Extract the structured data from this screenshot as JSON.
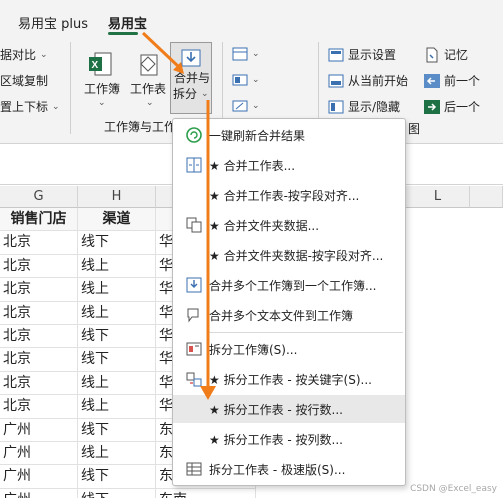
{
  "tabs": [
    {
      "label": "易用宝 plus",
      "active": false
    },
    {
      "label": "易用宝",
      "active": true
    }
  ],
  "ribbon": {
    "left_items": [
      "据对比",
      "区域复制",
      "置上下标"
    ],
    "workbook_label": "工作簿",
    "worksheet_label": "工作表",
    "merge_label_line1": "合并与",
    "merge_label_line2": "拆分",
    "group_label_partial": "工作簿与工作",
    "right_items": [
      "显示设置",
      "从当前开始",
      "显示/隐藏"
    ],
    "far_right_items": [
      "记忆",
      "前一个",
      "后一个"
    ],
    "group_label_right_partial": "图"
  },
  "columns": [
    "G",
    "H",
    "I",
    "L"
  ],
  "table": {
    "headers": [
      "销售门店",
      "渠道"
    ],
    "rows": [
      [
        "北京",
        "线下",
        "华"
      ],
      [
        "北京",
        "线上",
        "华"
      ],
      [
        "北京",
        "线上",
        "华"
      ],
      [
        "北京",
        "线上",
        "华"
      ],
      [
        "北京",
        "线下",
        "华"
      ],
      [
        "北京",
        "线下",
        "华"
      ],
      [
        "北京",
        "线上",
        "华"
      ],
      [
        "北京",
        "线上",
        "华"
      ],
      [
        "广州",
        "线下",
        "东"
      ],
      [
        "广州",
        "线上",
        "东"
      ],
      [
        "广州",
        "线下",
        "东"
      ],
      [
        "广州",
        "线下",
        "东南"
      ]
    ]
  },
  "menu": {
    "items": [
      {
        "label": "一键刷新合并结果",
        "icon": "refresh-icon"
      },
      {
        "label": "★ 合并工作表...",
        "icon": "merge-sheets-icon"
      },
      {
        "label": "★ 合并工作表-按字段对齐...",
        "icon": ""
      },
      {
        "label": "★ 合并文件夹数据...",
        "icon": "copy-files-icon"
      },
      {
        "label": "★ 合并文件夹数据-按字段对齐...",
        "icon": ""
      },
      {
        "label": "合并多个工作簿到一个工作簿...",
        "icon": "merge-workbooks-icon"
      },
      {
        "label": "合并多个文本文件到工作簿",
        "icon": "text-files-icon"
      },
      {
        "label": "拆分工作簿(S)...",
        "icon": "split-workbook-icon"
      },
      {
        "label": "★ 拆分工作表 - 按关键字(S)...",
        "icon": "split-key-icon"
      },
      {
        "label": "★ 拆分工作表 - 按行数...",
        "icon": ""
      },
      {
        "label": "★ 拆分工作表 - 按列数...",
        "icon": ""
      },
      {
        "label": "拆分工作表 - 极速版(S)...",
        "icon": "split-fast-icon"
      }
    ]
  },
  "watermark": "CSDN @Excel_easy",
  "colors": {
    "accent": "#217346",
    "annotation": "#f07c1a",
    "highlight": "#e8e8e8"
  }
}
